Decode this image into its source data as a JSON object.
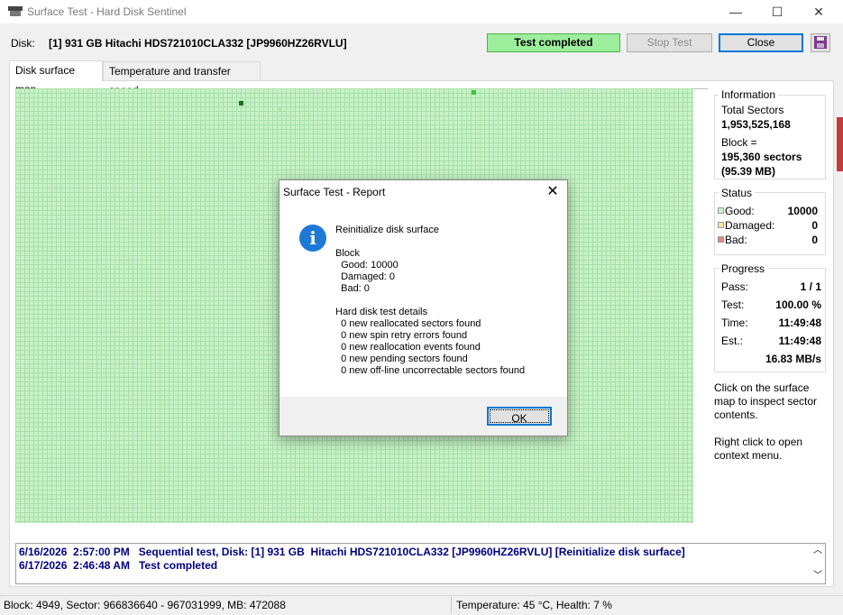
{
  "window": {
    "title": "Surface Test - Hard Disk Sentinel",
    "minimize": "—",
    "maximize": "☐",
    "close": "✕"
  },
  "header": {
    "disk_label": "Disk:",
    "disk_name": "[1] 931 GB  Hitachi HDS721010CLA332 [JP9960HZ26RVLU]",
    "status": "Test completed",
    "stop_button": "Stop Test",
    "close_button": "Close",
    "save_icon": "floppy-disk-icon"
  },
  "tabs": [
    {
      "label": "Disk surface map",
      "active": true
    },
    {
      "label": "Temperature and transfer speed",
      "active": false
    }
  ],
  "information": {
    "title": "Information",
    "total_sectors_label": "Total Sectors",
    "total_sectors_value": "1,953,525,168",
    "block_label": "Block =",
    "block_sectors": "195,360 sectors",
    "block_mb": "(95.39 MB)"
  },
  "status": {
    "title": "Status",
    "good_label": "Good:",
    "good_value": "10000",
    "damaged_label": "Damaged:",
    "damaged_value": "0",
    "bad_label": "Bad:",
    "bad_value": "0",
    "colors": {
      "good": "#c8f2c8",
      "damaged": "#f5e6a0",
      "bad": "#f08080"
    }
  },
  "progress": {
    "title": "Progress",
    "pass_label": "Pass:",
    "pass_value": "1 / 1",
    "test_label": "Test:",
    "test_value": "100.00 %",
    "time_label": "Time:",
    "time_value": "11:49:48",
    "est_label": "Est.:",
    "est_value": "11:49:48",
    "speed": "16.83 MB/s"
  },
  "hints": {
    "click": "Click on the surface map to inspect sector contents.",
    "right_click": "Right click to open context menu."
  },
  "log": [
    "6/16/2026  2:57:00 PM   Sequential test, Disk: [1] 931 GB  Hitachi HDS721010CLA332 [JP9960HZ26RVLU] [Reinitialize disk surface]",
    "6/17/2026  2:46:48 AM   Test completed"
  ],
  "statusbar": {
    "left": "Block: 4949, Sector: 966836640 - 967031999, MB: 472088",
    "right": "Temperature: 45  °C,  Health: 7 %"
  },
  "dialog": {
    "title": "Surface Test - Report",
    "heading": "Reinitialize disk surface",
    "block_title": "Block",
    "good": "  Good: 10000",
    "damaged": "  Damaged: 0",
    "bad": "  Bad: 0",
    "details_title": "Hard disk test details",
    "details": [
      "  0 new reallocated sectors found",
      "  0 new spin retry errors found",
      "  0 new reallocation events found",
      "  0 new pending sectors found",
      "  0 new off-line uncorrectable sectors found"
    ],
    "ok": "OK"
  }
}
